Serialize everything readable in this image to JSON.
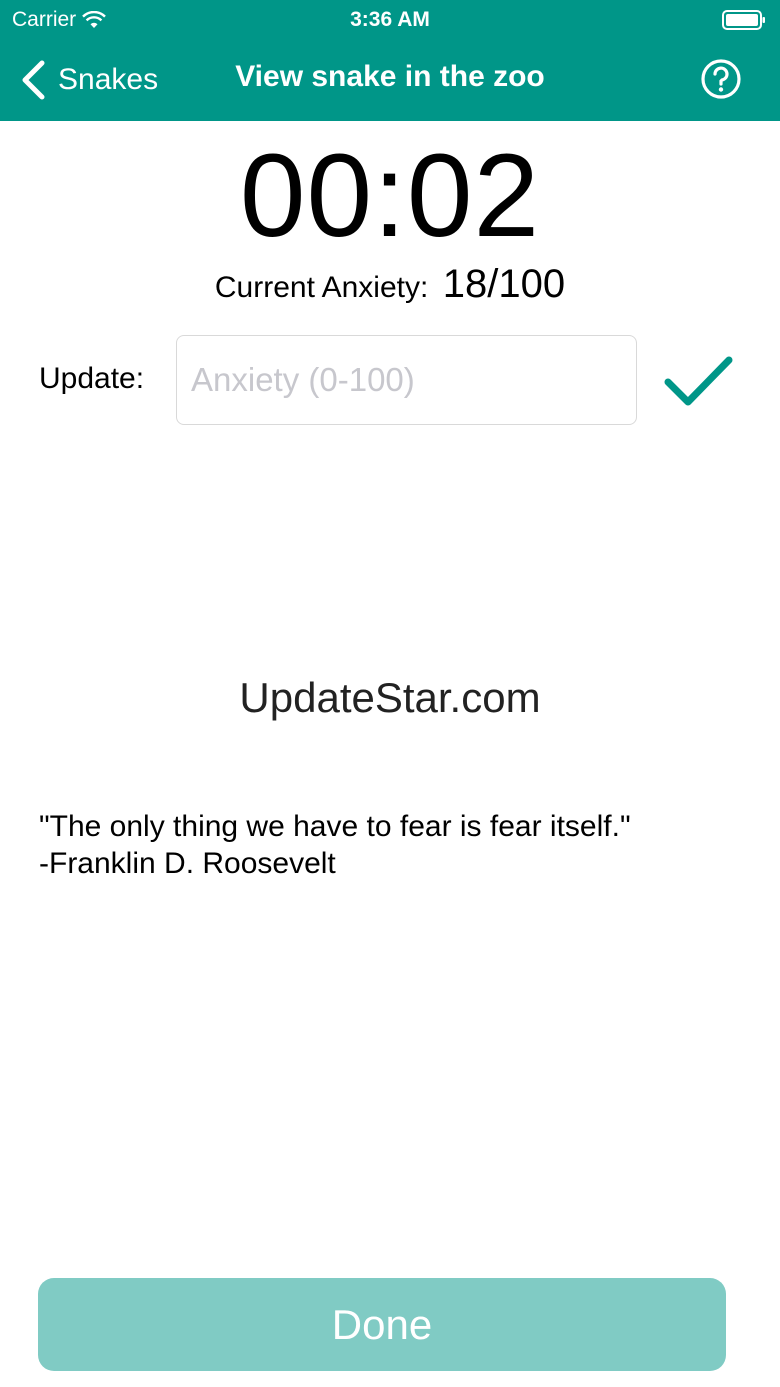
{
  "status_bar": {
    "carrier": "Carrier",
    "time": "3:36 AM",
    "wifi_icon": "wifi-icon",
    "battery_icon": "battery-full-icon"
  },
  "nav": {
    "back_label": "Snakes",
    "title": "View snake in the zoo",
    "help_icon": "question-circle-icon"
  },
  "timer": {
    "value": "00:02"
  },
  "anxiety": {
    "label": "Current Anxiety:",
    "value": "18/100"
  },
  "update": {
    "label": "Update:",
    "placeholder": "Anxiety (0-100)",
    "value": "",
    "submit_icon": "checkmark-icon"
  },
  "ad": {
    "text": "UpdateStar.com"
  },
  "quote": {
    "line1": "\"The only thing we have to fear is fear itself.\"",
    "line2": "-Franklin D. Roosevelt"
  },
  "done_button": {
    "label": "Done"
  },
  "colors": {
    "primary": "#009688",
    "done_disabled": "#80cbc4",
    "text": "#000000"
  }
}
